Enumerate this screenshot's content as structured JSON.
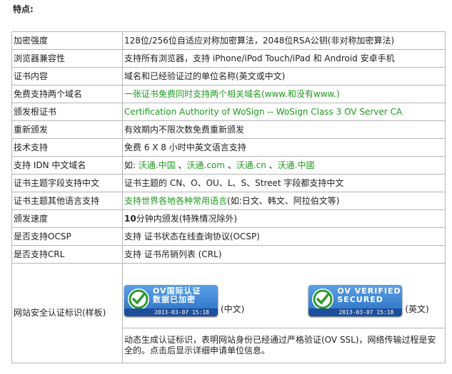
{
  "heading": "特点:",
  "rows": [
    {
      "label": "加密强度",
      "value": "128位/256位自适应对称加密算法，2048位RSA公钥(非对称加密算法)"
    },
    {
      "label": "浏览器兼容性",
      "value": "支持所有浏览器，支持 iPhone/iPod Touch/iPad 和 Android 安卓手机"
    },
    {
      "label": "证书内容",
      "value": "域名和已经验证过的单位名称(英文或中文)"
    },
    {
      "label": "免费支持两个域名",
      "value": "一张证书免费同时支持两个相关域名(www.和没有www.)"
    },
    {
      "label": "颁发根证书",
      "value": "Certification Authority of WoSign -- WoSign Class 3 OV Server CA"
    },
    {
      "label": "重新颁发",
      "value": "有效期内不限次数免费重新颁发"
    },
    {
      "label": "技术支持",
      "value": "免费 6 X 8 小时中英文语言支持"
    },
    {
      "label": "支持 IDN 中文域名",
      "value_prefix": "如: ",
      "idn": [
        "沃通.中国",
        "沃通.com",
        "沃通.cn",
        "沃通.中國"
      ],
      "idn_sep": " 、"
    },
    {
      "label": "证书主题字段支持中文",
      "value": "证书主题的 CN、O、OU、L、S、Street 字段都支持中文"
    },
    {
      "label": "证书主题其他语言支持",
      "value_green": "支持世界各地各种常用语言",
      "value_rest": "(如:日文、韩文、阿拉伯文等)"
    },
    {
      "label": "颁发速度",
      "value_bold": "10",
      "value_rest": "分钟内颁发(特殊情况除外)"
    },
    {
      "label": "是否支持OCSP",
      "value": "支持 证书状态在线查询协议(OCSP)"
    },
    {
      "label": "是否支持CRL",
      "value": "支持 证书吊销列表 (CRL)"
    }
  ],
  "seal_row": {
    "label": "网站安全认证标识(样板)",
    "badge_cn": {
      "line1": "OV国际认证",
      "line2": "数据已加密",
      "date": "2013-03-07 15:18",
      "caption": "(中文)"
    },
    "badge_en": {
      "line1": "OV VERIFIED",
      "line2": "SECURED",
      "date": "2013-03-07 15:18",
      "caption": "(英文)"
    },
    "description": "动态生成认证标识，表明网站身份已经通过严格验证(OV SSL)，网络传输过程是安全的。点击后显示详细申请单位信息。"
  },
  "colors": {
    "green": "#1f9a1f",
    "badge_blue": "#2a6fc4",
    "border": "#b5b5b5"
  }
}
